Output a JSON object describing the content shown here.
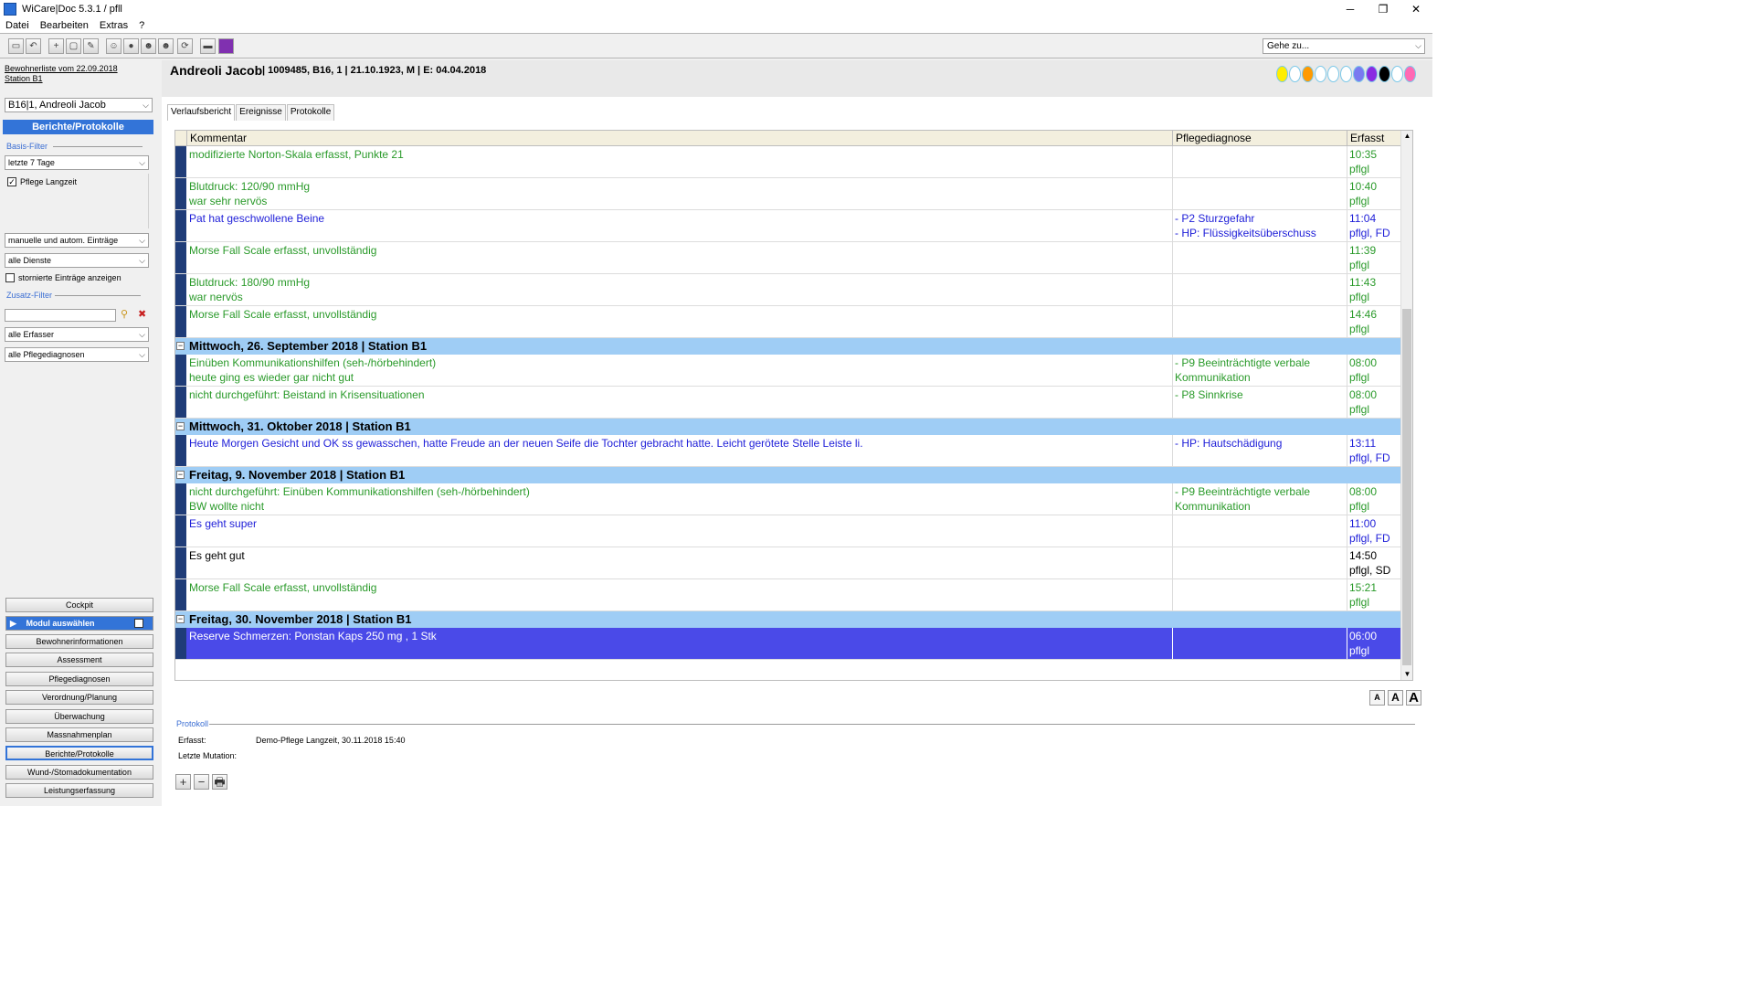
{
  "window": {
    "title": "WiCare|Doc 5.3.1  / pfll",
    "minimize": "─",
    "maximize": "❐",
    "close": "✕"
  },
  "menu": {
    "items": [
      "Datei",
      "Bearbeiten",
      "Extras",
      "?"
    ]
  },
  "toolbar": {
    "icons": [
      "save-icon",
      "undo-icon",
      "new-icon",
      "window-icon",
      "edit-icon",
      "users-icon",
      "person-icon",
      "person-add-icon",
      "person-remove-icon",
      "refresh-icon",
      "print-icon",
      "color-icon"
    ],
    "goto_label": "Gehe zu..."
  },
  "sidebar": {
    "resident_list": "Bewohnerliste vom 22.09.2018",
    "station": "Station B1",
    "resident_select": "B16|1, Andreoli Jacob",
    "section_title": "Berichte/Protokolle",
    "basis_filter_label": "Basis-Filter",
    "period_select": "letzte 7 Tage",
    "checkbox_pflege": "Pflege Langzeit",
    "entries_select": "manuelle und autom. Einträge",
    "services_select": "alle Dienste",
    "checkbox_storniert": "stornierte Einträge anzeigen",
    "zusatz_filter_label": "Zusatz-Filter",
    "erfasser_select": "alle Erfasser",
    "diagnosen_select": "alle Pflegediagnosen",
    "nav": {
      "cockpit": "Cockpit",
      "module": "Modul auswählen",
      "items": [
        "Bewohnerinformationen",
        "Assessment",
        "Pflegediagnosen",
        "Verordnung/Planung",
        "Überwachung",
        "Massnahmenplan",
        "Berichte/Protokolle",
        "Wund-/Stomadokumentation",
        "Leistungserfassung"
      ]
    }
  },
  "patient": {
    "name": "Andreoli Jacob",
    "meta": "| 1009485, B16, 1 | 21.10.1923, M | E: 04.04.2018",
    "dot_colors": [
      "#ffee00",
      "#ffffff",
      "#ff9a00",
      "#ffffff",
      "#ffffff",
      "#ffffff",
      "#7a7af0",
      "#8a2be2",
      "#000000",
      "#ffffff",
      "#ff69b4"
    ]
  },
  "tabs": [
    "Verlaufsbericht",
    "Ereignisse",
    "Protokolle"
  ],
  "grid": {
    "headers": [
      "Kommentar",
      "Pflegediagnose",
      "Erfasst"
    ],
    "rows": [
      {
        "type": "entry",
        "style": "green",
        "comment": [
          "modifizierte Norton-Skala erfasst, Punkte 21"
        ],
        "diagnosis": [],
        "recorded": [
          "10:35",
          "pflgl"
        ]
      },
      {
        "type": "entry",
        "style": "green",
        "comment": [
          "Blutdruck: 120/90 mmHg",
          "war sehr nervös"
        ],
        "diagnosis": [],
        "recorded": [
          "10:40",
          "pflgl"
        ]
      },
      {
        "type": "entry",
        "style": "blue",
        "comment": [
          "Pat hat geschwollene Beine"
        ],
        "diagnosis": [
          "- P2 Sturzgefahr",
          "- HP: Flüssigkeitsüberschuss"
        ],
        "recorded": [
          "11:04",
          "pflgl, FD"
        ]
      },
      {
        "type": "entry",
        "style": "green",
        "comment": [
          "Morse Fall Scale erfasst, unvollständig"
        ],
        "diagnosis": [],
        "recorded": [
          "11:39",
          "pflgl"
        ]
      },
      {
        "type": "entry",
        "style": "green",
        "comment": [
          "Blutdruck: 180/90 mmHg",
          "war nervös"
        ],
        "diagnosis": [],
        "recorded": [
          "11:43",
          "pflgl"
        ]
      },
      {
        "type": "entry",
        "style": "green",
        "comment": [
          "Morse Fall Scale erfasst, unvollständig"
        ],
        "diagnosis": [],
        "recorded": [
          "14:46",
          "pflgl"
        ]
      },
      {
        "type": "day",
        "label": "Mittwoch, 26. September 2018 | Station B1"
      },
      {
        "type": "entry",
        "style": "green",
        "comment": [
          "Einüben Kommunikationshilfen (seh-/hörbehindert)",
          "heute ging es wieder gar nicht gut"
        ],
        "diagnosis": [
          "- P9 Beeinträchtigte verbale",
          "Kommunikation"
        ],
        "recorded": [
          "08:00",
          "pflgl"
        ]
      },
      {
        "type": "entry",
        "style": "green",
        "comment": [
          "nicht durchgeführt: Beistand in Krisensituationen"
        ],
        "diagnosis": [
          "- P8 Sinnkrise"
        ],
        "recorded": [
          "08:00",
          "pflgl"
        ]
      },
      {
        "type": "day",
        "label": "Mittwoch, 31. Oktober 2018 | Station B1"
      },
      {
        "type": "entry",
        "style": "blue",
        "comment": [
          "Heute Morgen Gesicht und OK ss gewasschen, hatte Freude an der neuen Seife die Tochter gebracht hatte. Leicht gerötete Stelle Leiste li."
        ],
        "diagnosis": [
          "- HP: Hautschädigung"
        ],
        "recorded": [
          "13:11",
          "pflgl, FD"
        ]
      },
      {
        "type": "day",
        "label": "Freitag, 9. November 2018 | Station B1"
      },
      {
        "type": "entry",
        "style": "green",
        "comment": [
          "nicht durchgeführt: Einüben Kommunikationshilfen (seh-/hörbehindert)",
          "BW wollte nicht"
        ],
        "diagnosis": [
          "- P9 Beeinträchtigte verbale",
          "Kommunikation"
        ],
        "recorded": [
          "08:00",
          "pflgl"
        ]
      },
      {
        "type": "entry",
        "style": "blue",
        "comment": [
          "Es geht super"
        ],
        "diagnosis": [],
        "recorded": [
          "11:00",
          "pflgl, FD"
        ]
      },
      {
        "type": "entry",
        "style": "black",
        "comment": [
          "Es geht gut"
        ],
        "diagnosis": [],
        "recorded": [
          "14:50",
          "pflgl, SD"
        ]
      },
      {
        "type": "entry",
        "style": "green",
        "comment": [
          "Morse Fall Scale erfasst, unvollständig"
        ],
        "diagnosis": [],
        "recorded": [
          "15:21",
          "pflgl"
        ]
      },
      {
        "type": "day",
        "label": "Freitag, 30. November 2018 | Station B1"
      },
      {
        "type": "entry",
        "style": "sel",
        "comment": [
          "Reserve Schmerzen: Ponstan Kaps 250 mg , 1 Stk"
        ],
        "diagnosis": [],
        "recorded": [
          "06:00",
          "pflgl"
        ]
      }
    ]
  },
  "font_buttons": [
    "A",
    "A",
    "A"
  ],
  "protokoll": {
    "label": "Protokoll",
    "erfasst_label": "Erfasst:",
    "erfasst_value": "Demo-Pflege Langzeit, 30.11.2018 15:40",
    "mutation_label": "Letzte Mutation:"
  },
  "bottom_buttons": [
    "+",
    "−",
    "🖶"
  ]
}
